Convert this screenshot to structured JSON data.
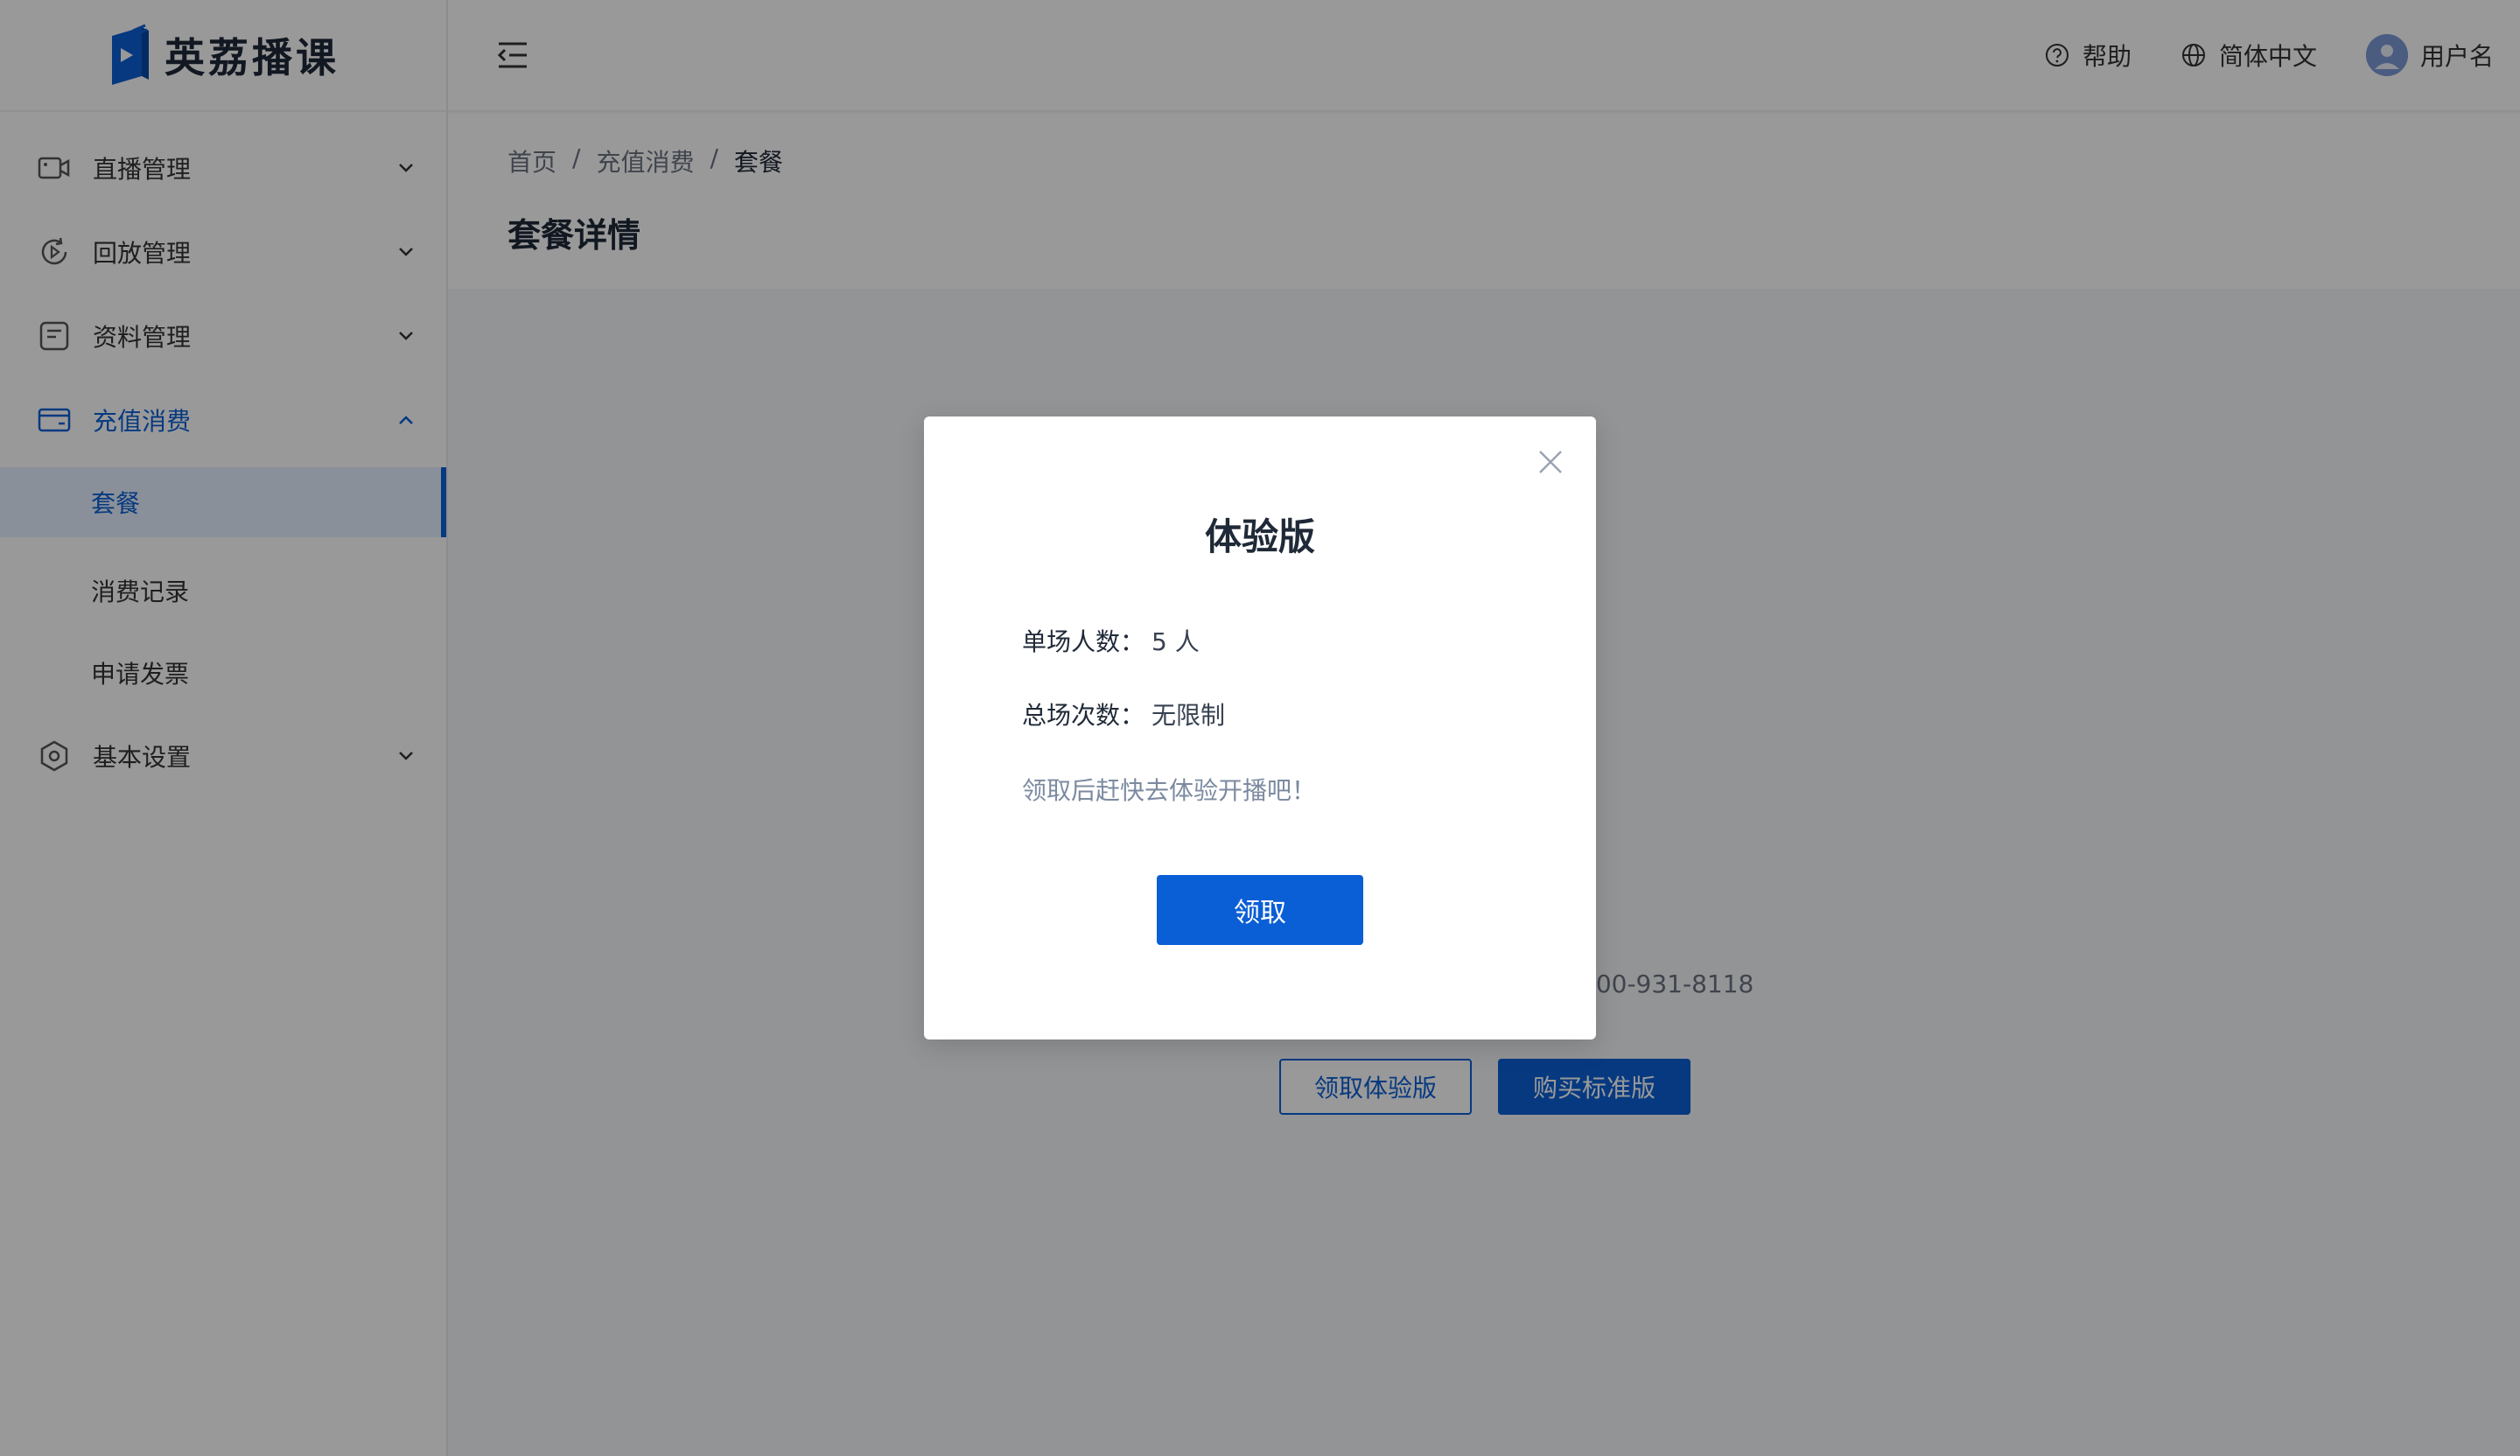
{
  "brand": {
    "name": "英荔播课"
  },
  "sidebar": {
    "items": [
      {
        "label": "直播管理",
        "icon": "camera-icon"
      },
      {
        "label": "回放管理",
        "icon": "replay-icon"
      },
      {
        "label": "资料管理",
        "icon": "document-icon"
      },
      {
        "label": "充值消费",
        "icon": "wallet-icon",
        "expanded": true,
        "children": [
          {
            "label": "套餐",
            "active": true
          },
          {
            "label": "消费记录"
          },
          {
            "label": "申请发票"
          }
        ]
      },
      {
        "label": "基本设置",
        "icon": "settings-icon"
      }
    ]
  },
  "header": {
    "help": "帮助",
    "language": "简体中文",
    "username": "用户名"
  },
  "breadcrumb": [
    "首页",
    "充值消费",
    "套餐"
  ],
  "page": {
    "title": "套餐详情",
    "phone_text": "400-931-8118",
    "btn_trial": "领取体验版",
    "btn_buy": "购买标准版"
  },
  "modal": {
    "title": "体验版",
    "rows": [
      {
        "key": "单场人数：",
        "value": "5 人"
      },
      {
        "key": "总场次数：",
        "value": "无限制"
      }
    ],
    "hint": "领取后赶快去体验开播吧！",
    "claim_label": "领取"
  },
  "colors": {
    "accent": "#0b5fd6",
    "overlay": "rgba(0,0,0,0.4)"
  }
}
